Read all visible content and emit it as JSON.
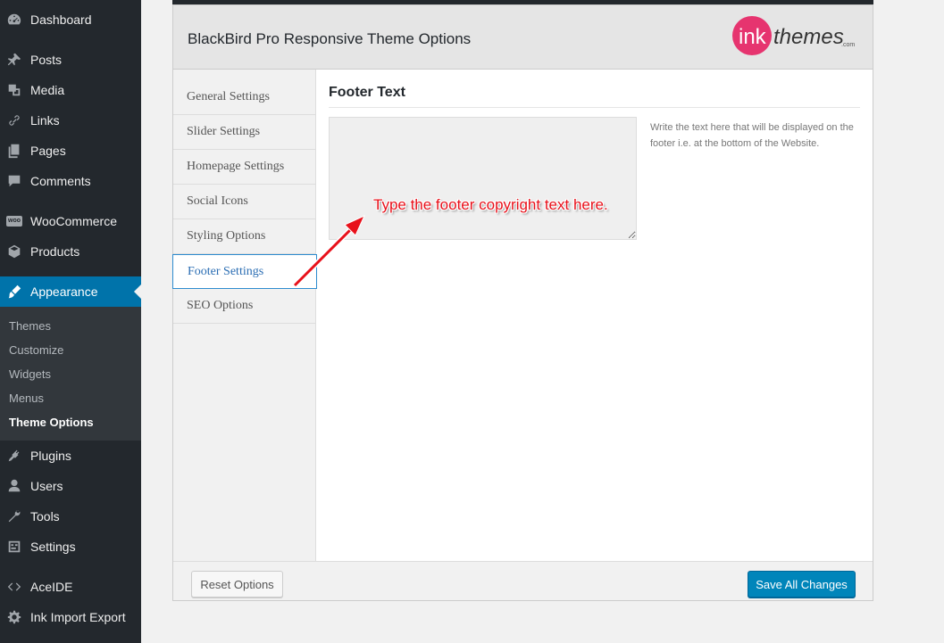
{
  "colors": {
    "sidebar_bg": "#23282d",
    "submenu_bg": "#32373c",
    "current_bg": "#0073aa",
    "save_button": "#0085ba",
    "annotation": "#e8101a",
    "logo_pink": "#e6346f"
  },
  "admin_menu": {
    "items": [
      {
        "label": "Dashboard",
        "icon": "dashboard-icon"
      },
      {
        "label": "Posts",
        "icon": "pin-icon"
      },
      {
        "label": "Media",
        "icon": "media-icon"
      },
      {
        "label": "Links",
        "icon": "link-icon"
      },
      {
        "label": "Pages",
        "icon": "pages-icon"
      },
      {
        "label": "Comments",
        "icon": "comment-icon"
      },
      {
        "label": "WooCommerce",
        "icon": "woo-icon",
        "icon_text": "woo"
      },
      {
        "label": "Products",
        "icon": "box-icon"
      },
      {
        "label": "Appearance",
        "icon": "brush-icon"
      },
      {
        "label": "Plugins",
        "icon": "plug-icon"
      },
      {
        "label": "Users",
        "icon": "users-icon"
      },
      {
        "label": "Tools",
        "icon": "wrench-icon"
      },
      {
        "label": "Settings",
        "icon": "settings-icon"
      },
      {
        "label": "AceIDE",
        "icon": "code-icon"
      },
      {
        "label": "Ink Import Export",
        "icon": "gear-icon"
      }
    ],
    "submenu": [
      {
        "label": "Themes"
      },
      {
        "label": "Customize"
      },
      {
        "label": "Widgets"
      },
      {
        "label": "Menus"
      },
      {
        "label": "Theme Options"
      }
    ]
  },
  "panel": {
    "title": "BlackBird Pro Responsive Theme Options",
    "logo": {
      "ink": "ink",
      "themes": "themes",
      "com": ".com"
    }
  },
  "tabs": [
    {
      "label": "General Settings"
    },
    {
      "label": "Slider Settings"
    },
    {
      "label": "Homepage Settings"
    },
    {
      "label": "Social Icons"
    },
    {
      "label": "Styling Options"
    },
    {
      "label": "Footer Settings"
    },
    {
      "label": "SEO Options"
    }
  ],
  "content": {
    "section_title": "Footer Text",
    "textarea_value": "",
    "help_text": "Write the text here that will be displayed on the footer i.e. at the bottom of the Website."
  },
  "annotation": {
    "text": "Type the footer copyright text here."
  },
  "buttons": {
    "reset": "Reset Options",
    "save": "Save All Changes"
  }
}
